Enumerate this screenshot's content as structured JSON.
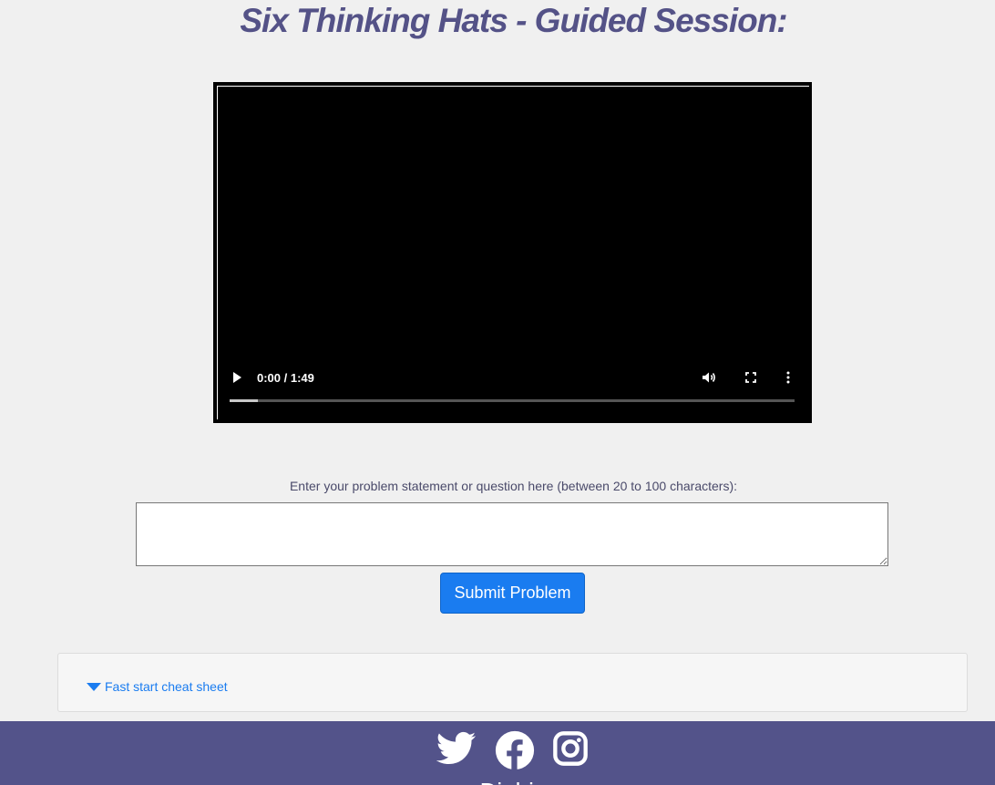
{
  "page": {
    "title": "Six Thinking Hats - Guided Session:"
  },
  "video": {
    "time_display": "0:00 / 1:49",
    "progress_fraction": 0.05
  },
  "problem": {
    "label": "Enter your problem statement or question here (between 20 to 100 characters):",
    "value": "",
    "submit_label": "Submit Problem"
  },
  "cheat_sheet": {
    "toggle_label": "Fast start cheat sheet"
  },
  "footer": {
    "brand": "Digbig",
    "social": [
      "twitter-icon",
      "facebook-icon",
      "instagram-icon"
    ]
  },
  "colors": {
    "title": "#545287",
    "accent": "#1a7cf0",
    "footer": "#53538a",
    "background": "#f0f0f0"
  }
}
